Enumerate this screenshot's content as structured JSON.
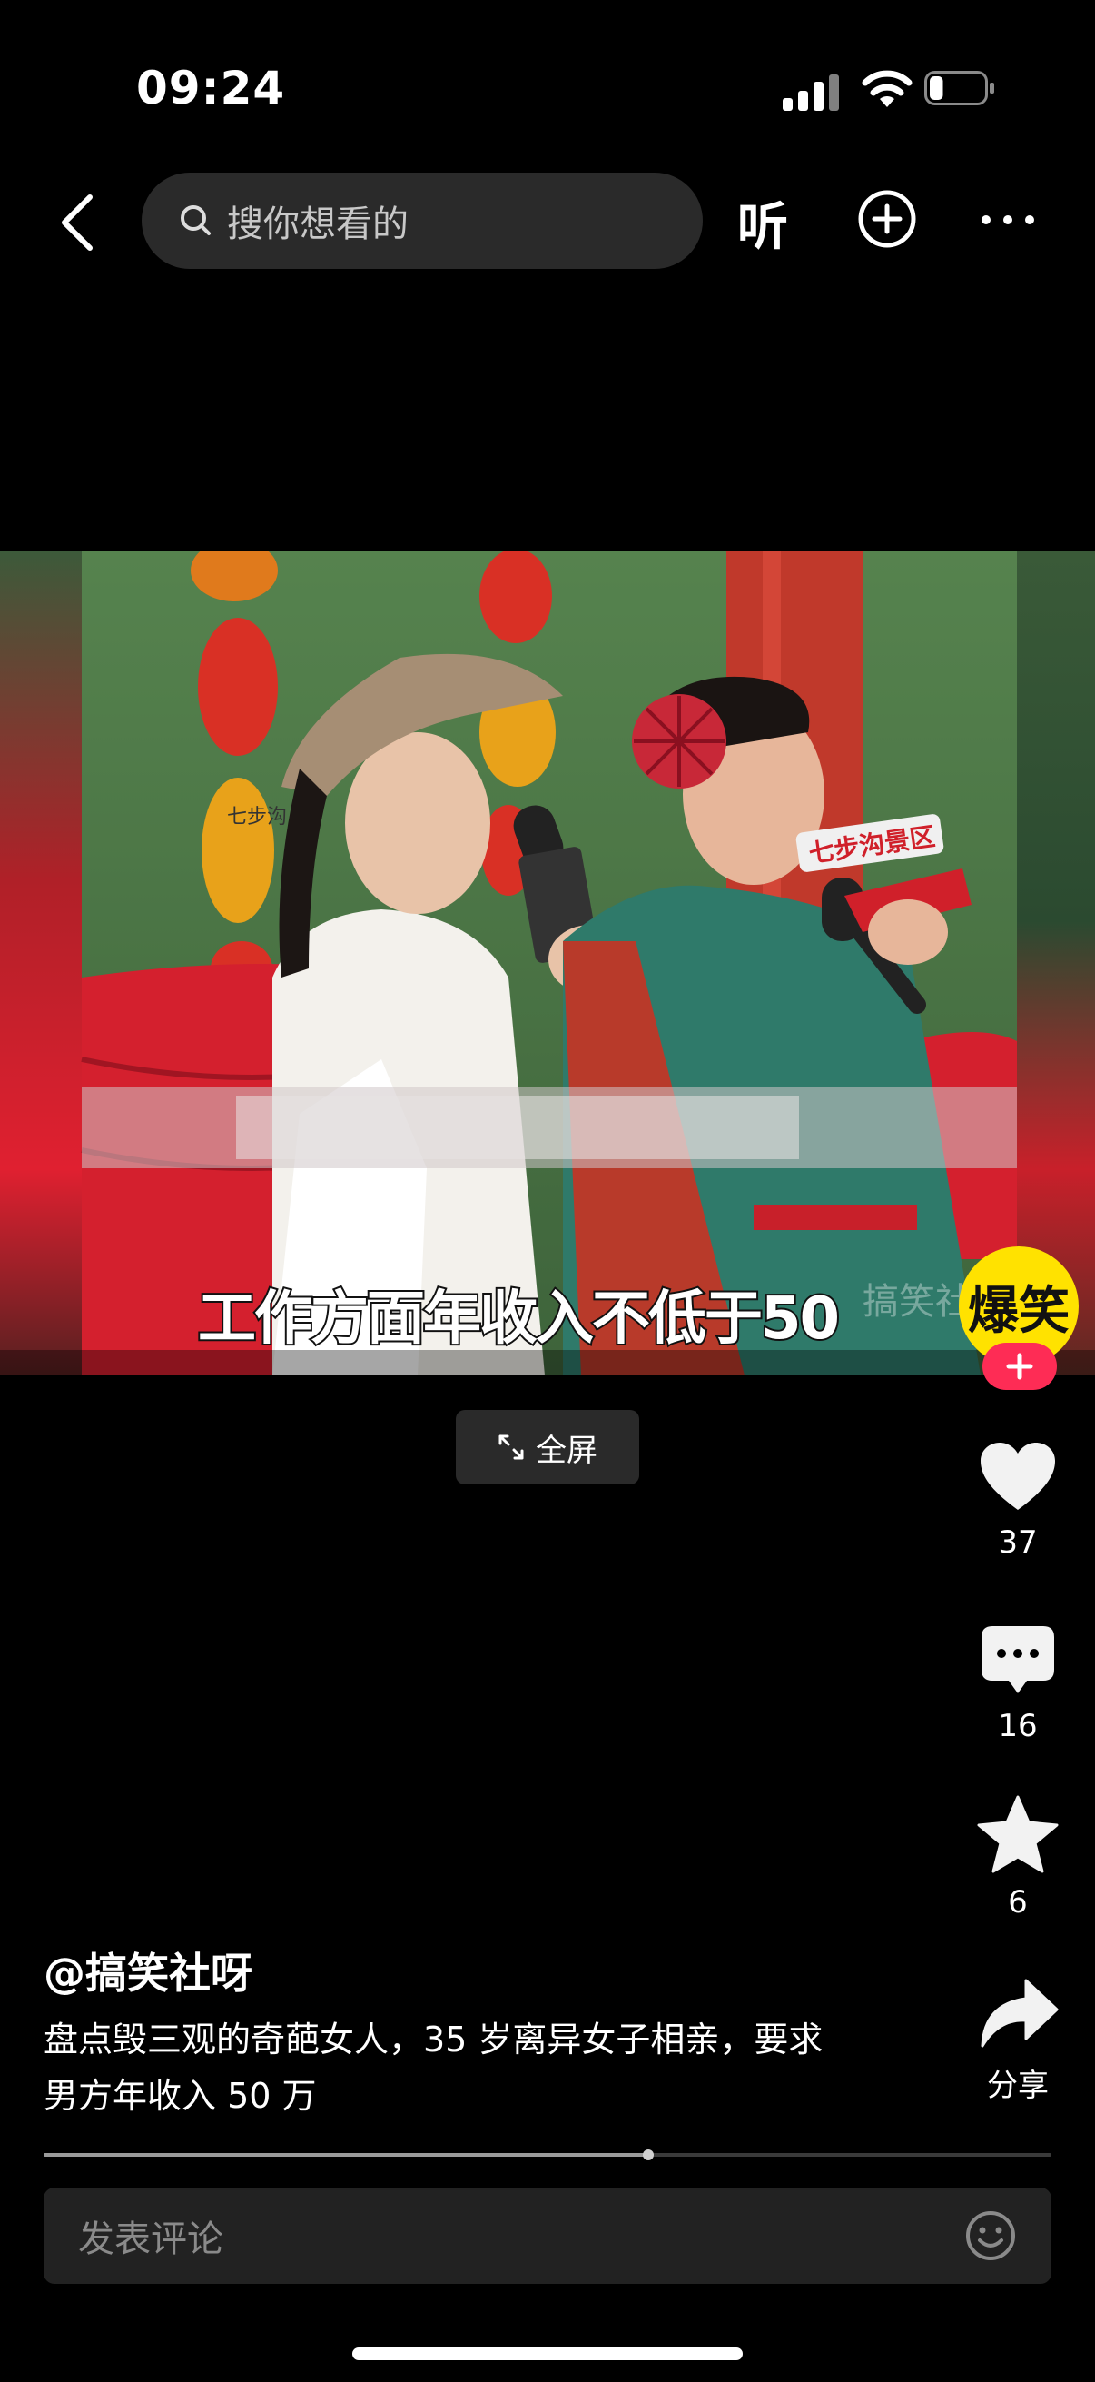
{
  "status_bar": {
    "time": "09:24",
    "battery_level": 0.25
  },
  "top_bar": {
    "back_icon": "chevron-left-icon",
    "search_placeholder": "搜你想看的",
    "listen_label": "听",
    "add_icon": "plus-circle-icon",
    "more_icon": "ellipsis-icon"
  },
  "video": {
    "subtitle": "工作方面年收入不低于50",
    "sign_text": "七步沟景区",
    "lantern_text": "七步沟",
    "channel_logo_text": "爆笑",
    "faint_watermark": "搞笑社"
  },
  "fullscreen_label": "全屏",
  "actions": {
    "like_count": "37",
    "comment_count": "16",
    "favorite_count": "6",
    "share_label": "分享"
  },
  "caption": {
    "author": "@搞笑社呀",
    "line1": "盘点毁三观的奇葩女人，35 岁离异女子相亲，要求",
    "line2": "男方年收入 50 万"
  },
  "progress": 0.6,
  "comment_placeholder": "发表评论",
  "colors": {
    "accent": "#fe2c55",
    "background": "#000000"
  }
}
